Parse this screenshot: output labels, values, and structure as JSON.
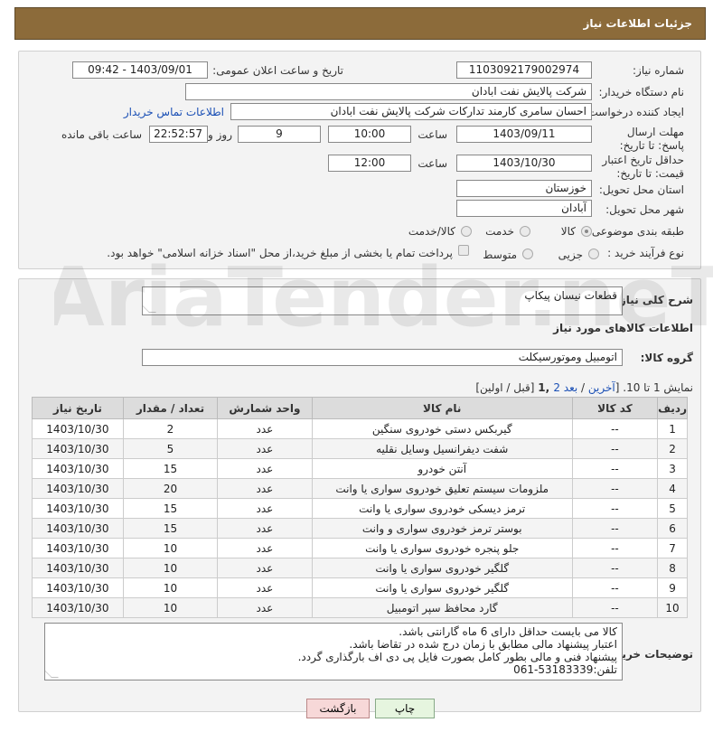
{
  "header": {
    "title": "جزئیات اطلاعات نیاز"
  },
  "form": {
    "need_number_label": "شماره نیاز:",
    "need_number": "1103092179002974",
    "announce_label": "تاریخ و ساعت اعلان عمومی:",
    "announce_value": "1403/09/01 - 09:42",
    "buyer_org_label": "نام دستگاه خریدار:",
    "buyer_org": "شرکت پالایش نفت ابادان",
    "requester_label": "ایجاد کننده درخواست:",
    "requester": "احسان سامری کارمند تدارکات شرکت پالایش نفت ابادان",
    "contact_link": "اطلاعات تماس خریدار",
    "reply_deadline_label": "مهلت ارسال پاسخ: تا تاریخ:",
    "reply_date": "1403/09/11",
    "time_label": "ساعت",
    "reply_time": "10:00",
    "days_value": "9",
    "days_label": "روز و",
    "remaining_time": "22:52:57",
    "remaining_label": "ساعت باقی مانده",
    "validity_label": "حداقل تاریخ اعتبار قیمت: تا تاریخ:",
    "validity_date": "1403/10/30",
    "validity_time": "12:00",
    "province_label": "استان محل تحویل:",
    "province": "خوزستان",
    "city_label": "شهر محل تحویل:",
    "city": "آبادان",
    "category_label": "طبقه بندی موضوعی:",
    "category_options": [
      "کالا",
      "خدمت",
      "کالا/خدمت"
    ],
    "process_label": "نوع فرآیند خرید :",
    "process_options": [
      "جزیی",
      "متوسط"
    ],
    "payment_note": "پرداخت تمام یا بخشی از مبلغ خرید،از محل \"اسناد خزانه اسلامی\" خواهد بود."
  },
  "details": {
    "description_label": "شرح کلی نیاز:",
    "description": "قطعات نیسان پیکاپ",
    "goods_info_title": "اطلاعات کالاهای مورد نیاز",
    "goods_group_label": "گروه کالا:",
    "goods_group": "اتومبیل وموتورسیکلت",
    "pagination": {
      "prefix": "نمایش 1 تا 10. [",
      "last": "آخرین",
      "sep1": " / ",
      "next": "بعد",
      "page2": "2",
      "page1": " ,1",
      "suffix": " [قبل / اولین]"
    },
    "table": {
      "headers": [
        "ردیف",
        "کد کالا",
        "نام کالا",
        "واحد شمارش",
        "تعداد / مقدار",
        "تاریخ نیاز"
      ],
      "rows": [
        [
          "1",
          "--",
          "گیربکس دستی خودروی سنگین",
          "عدد",
          "2",
          "1403/10/30"
        ],
        [
          "2",
          "--",
          "شفت دیفرانسیل وسایل نقلیه",
          "عدد",
          "5",
          "1403/10/30"
        ],
        [
          "3",
          "--",
          "آنتن خودرو",
          "عدد",
          "15",
          "1403/10/30"
        ],
        [
          "4",
          "--",
          "ملزومات سیستم تعلیق خودروی سواری یا وانت",
          "عدد",
          "20",
          "1403/10/30"
        ],
        [
          "5",
          "--",
          "ترمز دیسکی خودروی سواری یا وانت",
          "عدد",
          "15",
          "1403/10/30"
        ],
        [
          "6",
          "--",
          "بوستر ترمز خودروی سواری و وانت",
          "عدد",
          "15",
          "1403/10/30"
        ],
        [
          "7",
          "--",
          "جلو پنجره خودروی سواری یا وانت",
          "عدد",
          "10",
          "1403/10/30"
        ],
        [
          "8",
          "--",
          "گلگیر خودروی سواری یا وانت",
          "عدد",
          "10",
          "1403/10/30"
        ],
        [
          "9",
          "--",
          "گلگیر خودروی سواری یا وانت",
          "عدد",
          "10",
          "1403/10/30"
        ],
        [
          "10",
          "--",
          "گارد محافظ سپر اتومبیل",
          "عدد",
          "10",
          "1403/10/30"
        ]
      ]
    },
    "buyer_notes_label": "توضیحات خریدار:",
    "buyer_notes": [
      "کالا می بایست حداقل دارای 6 ماه گارانتی باشد.",
      "اعتبار پیشنهاد مالی مطابق با زمان درج شده در تقاضا باشد.",
      "پیشنهاد فنی و مالی بطور کامل بصورت فایل پی دی اف بارگذاری گردد.",
      "تلفن:53183339-061"
    ]
  },
  "buttons": {
    "print": "چاپ",
    "back": "بازگشت"
  },
  "watermark": {
    "text": "AriaTender.neT"
  }
}
